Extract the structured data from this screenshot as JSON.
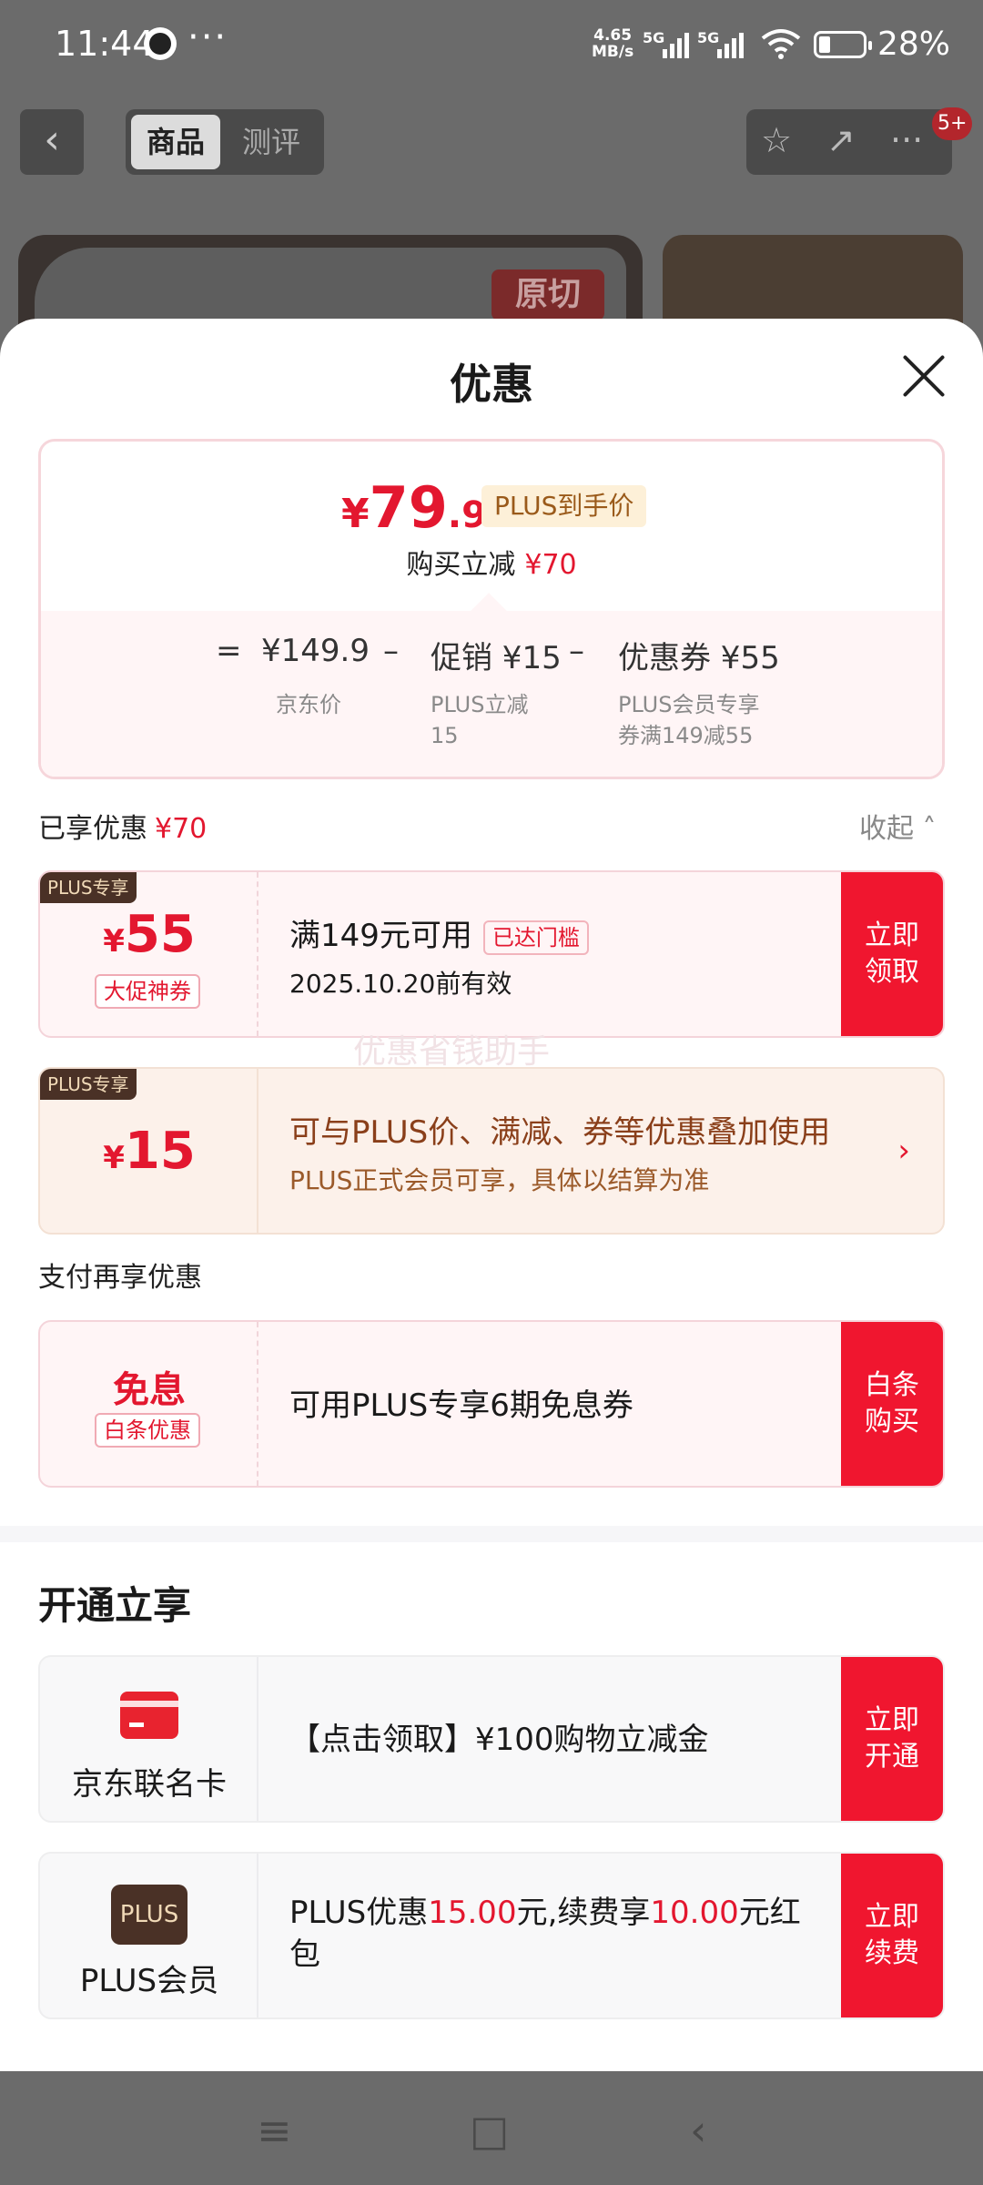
{
  "status": {
    "time": "11:44",
    "more": "···",
    "speed_top": "4.65",
    "speed_bottom": "MB/s",
    "sig1": "5G",
    "sig2": "5G",
    "battery_pct": "28%"
  },
  "header": {
    "back_glyph": "‹",
    "tab_goods": "商品",
    "tab_review": "测评",
    "star_glyph": "☆",
    "share_glyph": "↗",
    "menu_glyph": "···",
    "badge": "5+",
    "bg_stamp": "原切"
  },
  "sheet": {
    "title": "优惠",
    "summary": {
      "yen": "¥",
      "int": "79",
      "dec": ".9",
      "plus_label": "PLUS到手价",
      "reduce_label": "购买立减",
      "reduce_value": "¥70",
      "eq": "=",
      "jd_price": "¥149.9",
      "minus1": "–",
      "promo": "促销 ¥15",
      "minus2": "–",
      "coupon": "优惠券 ¥55",
      "jd_price_label": "京东价",
      "promo_label_1": "PLUS立减",
      "promo_label_2": "15",
      "coupon_label_1": "PLUS会员专享",
      "coupon_label_2": "券满149减55"
    },
    "enjoyed_label": "已享优惠",
    "enjoyed_value": "¥70",
    "collapse_label": "收起 ˄",
    "coupons": [
      {
        "tag": "PLUS专享",
        "yen": "¥",
        "amount": "55",
        "sub_tag": "大促神券",
        "line1": "满149元可用",
        "reached": "已达门槛",
        "line2": "2025.10.20前有效",
        "cta_1": "立即",
        "cta_2": "领取"
      },
      {
        "tag": "PLUS专享",
        "yen": "¥",
        "amount": "15",
        "line1": "可与PLUS价、满减、券等优惠叠加使用",
        "line2": "PLUS正式会员可享，具体以结算为准",
        "chevron": "›"
      }
    ],
    "watermark": "优惠省钱助手",
    "pay_label": "支付再享优惠",
    "pay_card": {
      "title": "免息",
      "sub_tag": "白条优惠",
      "text": "可用PLUS专享6期免息券",
      "cta_1": "白条",
      "cta_2": "购买"
    },
    "open_title": "开通立享",
    "members": [
      {
        "name": "京东联名卡",
        "text": "【点击领取】¥100购物立减金",
        "cta_1": "立即",
        "cta_2": "开通"
      },
      {
        "icon_text": "PLUS",
        "name": "PLUS会员",
        "text_a": "PLUS优惠",
        "red_a": "15.00",
        "text_b": "元,续费享",
        "red_b": "10.00",
        "text_c": "元红包",
        "cta_1": "立即",
        "cta_2": "续费"
      }
    ]
  },
  "nav": {
    "menu": "≡",
    "home": "□",
    "back": "‹"
  },
  "colors": {
    "accent_red": "#f0162f",
    "price_red": "#e3172f",
    "plus_brown": "#4a3126"
  }
}
